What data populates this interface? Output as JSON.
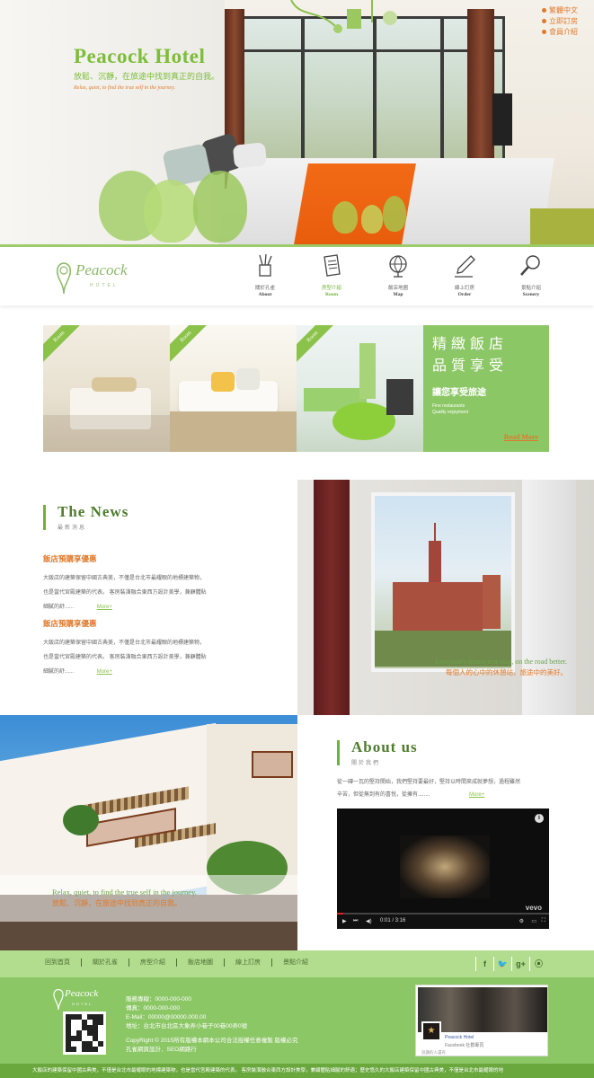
{
  "hero": {
    "title": "Peacock Hotel",
    "subtitle_zh": "放鬆、沉靜，在旅途中找到真正的自我。",
    "subtitle_en": "Relax, quiet, to find the true self in the journey."
  },
  "language_links": [
    "繁體中文",
    "立即訂房",
    "會員介紹"
  ],
  "logo": {
    "word": "Peacock",
    "tag": "HOTEL"
  },
  "nav": [
    {
      "zh": "關於孔雀",
      "en": "About",
      "icon": "pencil-cup-icon"
    },
    {
      "zh": "房型介紹",
      "en": "Room",
      "icon": "document-icon"
    },
    {
      "zh": "飯店地圖",
      "en": "Map",
      "icon": "globe-icon"
    },
    {
      "zh": "線上訂房",
      "en": "Order",
      "icon": "pen-icon"
    },
    {
      "zh": "景點介紹",
      "en": "Scenery",
      "icon": "magnifier-icon"
    }
  ],
  "active_nav": "Room",
  "rooms": {
    "ribbon_label": "Room",
    "promo": {
      "line1": "精緻飯店",
      "line2": "品質享受",
      "cta": "讓您享受旅途",
      "small1": "Fine restaurants",
      "small2": "Quality enjoyment",
      "more": "Read More"
    }
  },
  "news": {
    "heading_en": "The News",
    "heading_zh": "最新消息",
    "items": [
      {
        "title": "飯店預購享優惠",
        "line1": "大飯店的建築保留中國古典美，不僅是台北市最耀眼的地標建築物，",
        "line2": "也是當代宮殿建築的代表。 客房裝潢融合東西方設計美學，兼顧體貼",
        "line3": "細膩的舒......",
        "more": "More+"
      },
      {
        "title": "飯店預購享優惠",
        "line1": "大飯店的建築保留中國古典美，不僅是台北市最耀眼的地標建築物，",
        "line2": "也是當代宮殿建築的代表。 客房裝潢融合東西方設計美學，兼顧體貼",
        "line3": "細膩的舒......",
        "more": "More+"
      }
    ]
  },
  "moscow_caption": {
    "en": "Everyone's hearts rest stop, on the road better.",
    "zh": "每個人的心中的休憩站，旅途中的美好。"
  },
  "villa_caption": {
    "en": "Relax, quiet, to find the true self in the journey.",
    "zh": "放鬆、沉靜，在旅途中找到真正的自我。"
  },
  "about": {
    "heading_en": "About us",
    "heading_zh": "關於我們",
    "line1": "從一磚一瓦的堅持開始，我們堅持要最好，堅持以時間來成就夢想，過程雖然",
    "line2": "辛苦，但從無到有的喜悅，從擁有........",
    "more": "More+"
  },
  "video": {
    "time": "0:01 / 3:16",
    "brand": "vevo",
    "progress_fraction": 0.03
  },
  "footer_nav": [
    "回到首頁",
    "關於孔雀",
    "房型介紹",
    "飯店地圖",
    "線上訂房",
    "景點介紹"
  ],
  "social": [
    "f",
    "t",
    "g+",
    "rss"
  ],
  "contact": {
    "service": "服務專線：0000-000-000",
    "fax": "傳真：0000-000-000",
    "email": "E-Mail：00000@00000.000.00",
    "address": "地址：台北市台北區大象弄小巷子00巷00弄0號",
    "copyright": "CopyRight © 2015所有版權本網本公司合法授權任意複製 版權必究",
    "design": "孔雀網頁設計．SEO網路行"
  },
  "facebook": {
    "line1": "Peacock Hotel",
    "line2": "Facebook 社群專頁",
    "line3": "說讚的人還有"
  },
  "bottom_bar": "大飯店的建築保留中國古典美，不僅是台北市最耀眼的地標建築物，也是當代宮殿建築的代表。 客房裝潢融合東西方設計美學，兼顧體貼細膩的舒適；歷史悠久的大飯店建築保留中國古典美，不僅是台北市最耀眼的地"
}
